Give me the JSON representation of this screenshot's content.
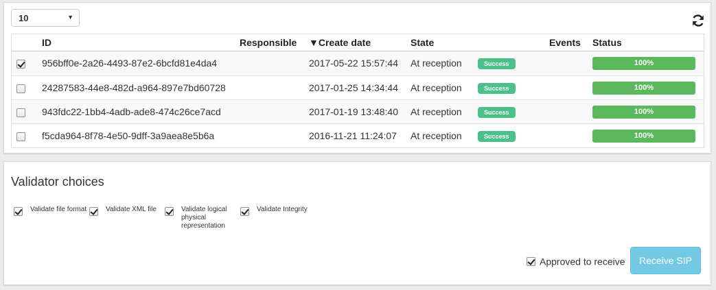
{
  "list_panel": {
    "page_size": "10",
    "columns": {
      "id": "ID",
      "responsible": "Responsible",
      "create_date": "Create date",
      "sort_indicator": "▼",
      "state": "State",
      "events": "Events",
      "status": "Status"
    },
    "rows": [
      {
        "checked": true,
        "id": "956bff0e-2a26-4493-87e2-6bcfd81e4da4",
        "responsible": "",
        "create_date": "2017-05-22 15:57:44",
        "state": "At reception",
        "badge": "Success",
        "events": "",
        "progress_label": "100%",
        "progress": 1.0
      },
      {
        "checked": false,
        "id": "24287583-44e8-482d-a964-897e7bd60728",
        "responsible": "",
        "create_date": "2017-01-25 14:34:44",
        "state": "At reception",
        "badge": "Success",
        "events": "",
        "progress_label": "100%",
        "progress": 1.0
      },
      {
        "checked": false,
        "id": "943fdc22-1bb4-4adb-ade8-474c26ce7acd",
        "responsible": "",
        "create_date": "2017-01-19 13:48:40",
        "state": "At reception",
        "badge": "Success",
        "events": "",
        "progress_label": "100%",
        "progress": 1.0
      },
      {
        "checked": false,
        "id": "f5cda964-8f78-4e50-9dff-3a9aea8e5b6a",
        "responsible": "",
        "create_date": "2016-11-21 11:24:07",
        "state": "At reception",
        "badge": "Success",
        "events": "",
        "progress_label": "100%",
        "progress": 1.0
      }
    ],
    "icons": {
      "refresh": "refresh-icon",
      "dropdown": "chevron-down-icon"
    }
  },
  "validator": {
    "title": "Validator choices",
    "options": [
      {
        "label": "Validate file format",
        "checked": true
      },
      {
        "label": "Validate XML file",
        "checked": true
      },
      {
        "label": "Validate logical physical representation",
        "checked": true
      },
      {
        "label": "Validate Integrity",
        "checked": true
      }
    ],
    "approved_label": "Approved to receive",
    "approved_checked": true,
    "receive_button": "Receive SIP"
  },
  "colors": {
    "success_badge": "#4cc08a",
    "progress_fill": "#5cb85c",
    "receive_button": "#5bc0de"
  }
}
